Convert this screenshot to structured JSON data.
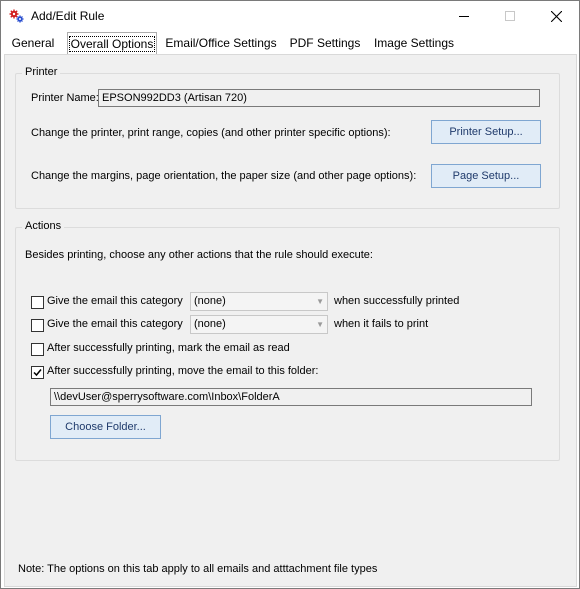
{
  "window": {
    "title": "Add/Edit Rule"
  },
  "tabs": [
    {
      "label": "General"
    },
    {
      "label": "Overall Options"
    },
    {
      "label": "Email/Office Settings"
    },
    {
      "label": "PDF Settings"
    },
    {
      "label": "Image Settings"
    }
  ],
  "printer": {
    "group_title": "Printer",
    "name_label": "Printer Name:",
    "name_value": "EPSON992DD3 (Artisan 720)",
    "setup_desc": "Change the printer, print range, copies (and other printer specific options):",
    "setup_button": "Printer Setup...",
    "page_desc": "Change the margins, page orientation, the paper size (and other page options):",
    "page_button": "Page Setup..."
  },
  "actions": {
    "group_title": "Actions",
    "intro": "Besides printing, choose any other actions that the rule should execute:",
    "category_success": {
      "checked": false,
      "label": "Give the email this category",
      "value": "(none)",
      "suffix": "when successfully printed"
    },
    "category_fail": {
      "checked": false,
      "label": "Give the email this category",
      "value": "(none)",
      "suffix": "when it fails to print"
    },
    "mark_read": {
      "checked": false,
      "label": "After successfully printing, mark the email as read"
    },
    "move_folder": {
      "checked": true,
      "label": "After successfully printing, move the email to this folder:",
      "path": "\\\\devUser@sperrysoftware.com\\Inbox\\FolderA",
      "choose_button": "Choose Folder..."
    }
  },
  "note": "Note: The options on this tab apply to all emails and atttachment file types"
}
